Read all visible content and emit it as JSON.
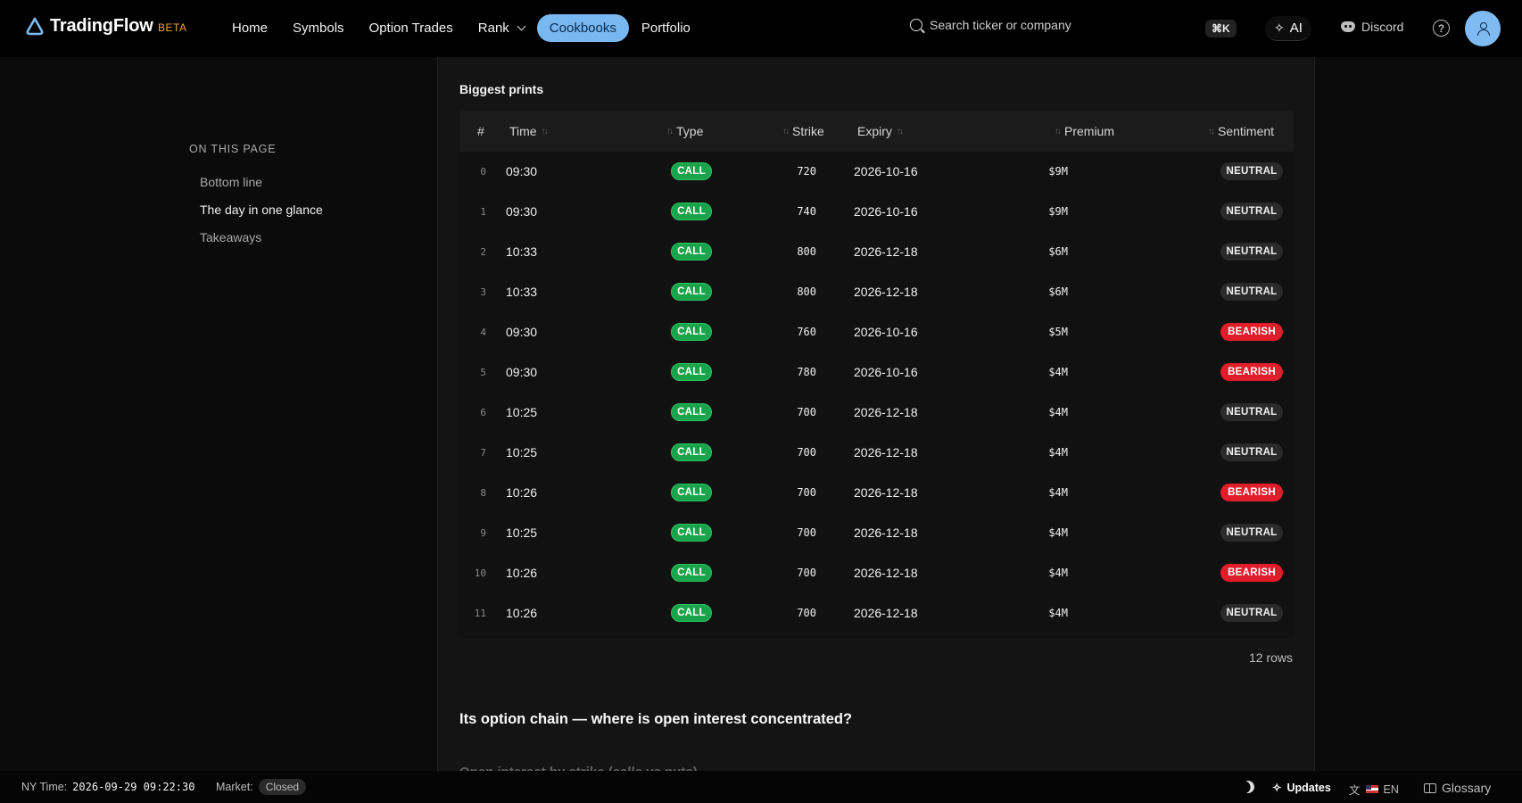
{
  "app": {
    "name": "TradingFlow",
    "badge": "BETA"
  },
  "nav": {
    "items": [
      {
        "label": "Home"
      },
      {
        "label": "Symbols"
      },
      {
        "label": "Option Trades"
      },
      {
        "label": "Rank"
      },
      {
        "label": "Cookbooks",
        "active": true
      },
      {
        "label": "Portfolio"
      }
    ]
  },
  "search": {
    "placeholder": "Search ticker or company",
    "shortcut": "⌘K"
  },
  "header_actions": {
    "ai_label": "AI",
    "discord_label": "Discord"
  },
  "toc": {
    "title": "ON THIS PAGE",
    "items": [
      {
        "label": "Bottom line"
      },
      {
        "label": "The day in one glance",
        "current": true
      },
      {
        "label": "Takeaways"
      }
    ]
  },
  "section": {
    "title": "Biggest prints"
  },
  "table": {
    "columns": {
      "index": "#",
      "time": "Time",
      "type": "Type",
      "strike": "Strike",
      "expiry": "Expiry",
      "premium": "Premium",
      "sentiment": "Sentiment"
    },
    "rows": [
      {
        "idx": "0",
        "time": "09:30",
        "type": "CALL",
        "strike": "720",
        "expiry": "2026-10-16",
        "premium": "$9M",
        "sentiment": "NEUTRAL"
      },
      {
        "idx": "1",
        "time": "09:30",
        "type": "CALL",
        "strike": "740",
        "expiry": "2026-10-16",
        "premium": "$9M",
        "sentiment": "NEUTRAL"
      },
      {
        "idx": "2",
        "time": "10:33",
        "type": "CALL",
        "strike": "800",
        "expiry": "2026-12-18",
        "premium": "$6M",
        "sentiment": "NEUTRAL"
      },
      {
        "idx": "3",
        "time": "10:33",
        "type": "CALL",
        "strike": "800",
        "expiry": "2026-12-18",
        "premium": "$6M",
        "sentiment": "NEUTRAL"
      },
      {
        "idx": "4",
        "time": "09:30",
        "type": "CALL",
        "strike": "760",
        "expiry": "2026-10-16",
        "premium": "$5M",
        "sentiment": "BEARISH"
      },
      {
        "idx": "5",
        "time": "09:30",
        "type": "CALL",
        "strike": "780",
        "expiry": "2026-10-16",
        "premium": "$4M",
        "sentiment": "BEARISH"
      },
      {
        "idx": "6",
        "time": "10:25",
        "type": "CALL",
        "strike": "700",
        "expiry": "2026-12-18",
        "premium": "$4M",
        "sentiment": "NEUTRAL"
      },
      {
        "idx": "7",
        "time": "10:25",
        "type": "CALL",
        "strike": "700",
        "expiry": "2026-12-18",
        "premium": "$4M",
        "sentiment": "NEUTRAL"
      },
      {
        "idx": "8",
        "time": "10:26",
        "type": "CALL",
        "strike": "700",
        "expiry": "2026-12-18",
        "premium": "$4M",
        "sentiment": "BEARISH"
      },
      {
        "idx": "9",
        "time": "10:25",
        "type": "CALL",
        "strike": "700",
        "expiry": "2026-12-18",
        "premium": "$4M",
        "sentiment": "NEUTRAL"
      },
      {
        "idx": "10",
        "time": "10:26",
        "type": "CALL",
        "strike": "700",
        "expiry": "2026-12-18",
        "premium": "$4M",
        "sentiment": "BEARISH"
      },
      {
        "idx": "11",
        "time": "10:26",
        "type": "CALL",
        "strike": "700",
        "expiry": "2026-12-18",
        "premium": "$4M",
        "sentiment": "NEUTRAL"
      }
    ],
    "row_count": "12 rows"
  },
  "next_section": {
    "title": "Its option chain — where is open interest concentrated?"
  },
  "next_subsection": {
    "title": "Open interest by strike (calls vs puts)"
  },
  "status_bar": {
    "ny_time_label": "NY Time:",
    "ny_time_value": "2026-09-29 09:22:30",
    "market_label": "Market:",
    "market_value": "Closed",
    "updates_label": "Updates",
    "language_label": "EN",
    "glossary_label": "Glossary"
  },
  "colors": {
    "accent": "#79b7f0",
    "call": "#19a34a",
    "bearish": "#e11d2a",
    "beta": "#f0a43a"
  },
  "icons": [
    "logo-icon",
    "chevron-down-icon",
    "search-icon",
    "sparkle-icon",
    "discord-icon",
    "help-icon",
    "user-icon",
    "sort-icon",
    "moon-icon",
    "flag-icon",
    "book-icon"
  ]
}
